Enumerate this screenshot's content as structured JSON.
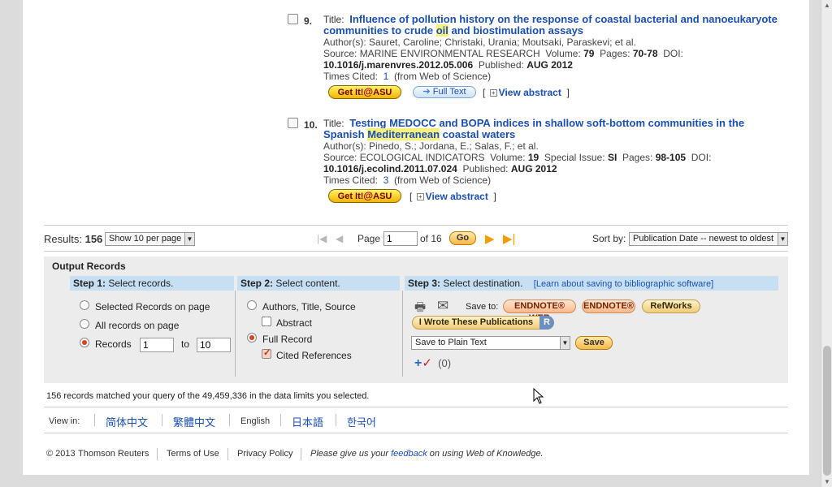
{
  "records": [
    {
      "number": "9.",
      "title_prefix": "Title:",
      "title_pre": "Influence of pollution history on the response of coastal bacterial and nanoeukaryote communities to crude ",
      "title_hl": "oil",
      "title_post": " and biostimulation assays",
      "authors": "Author(s): Sauret, Caroline; Christaki, Urania; Moutsaki, Paraskevi; et al.",
      "source_label": "Source: MARINE ENVIRONMENTAL RESEARCH",
      "volume_label": "Volume:",
      "volume": "79",
      "pages_label": "Pages:",
      "pages": "70-78",
      "doi_label": "DOI:",
      "doi": "10.1016/j.marenvres.2012.05.006",
      "published_label": "Published:",
      "published": "AUG 2012",
      "times_cited_label": "Times Cited:",
      "times_cited": "1",
      "times_cited_note": "(from Web of Science)",
      "get_it": "Get It!",
      "asu": "ASU",
      "full_text": "Full Text",
      "view_abstract": "View abstract"
    },
    {
      "number": "10.",
      "title_prefix": "Title:",
      "title_pre": "Testing MEDOCC and BOPA indices in shallow soft-bottom communities in the Spanish ",
      "title_hl": "Mediterranean",
      "title_post": " coastal waters",
      "authors": "Author(s): Pinedo, S.; Jordana, E.; Salas, F.; et al.",
      "source_label": "Source: ECOLOGICAL INDICATORS",
      "volume_label": "Volume:",
      "volume": "19",
      "special_label": "Special Issue:",
      "special": "SI",
      "pages_label": "Pages:",
      "pages": "98-105",
      "doi_label": "DOI:",
      "doi": "10.1016/j.ecolind.2011.07.024",
      "published_label": "Published:",
      "published": "AUG 2012",
      "times_cited_label": "Times Cited:",
      "times_cited": "3",
      "times_cited_note": "(from Web of Science)",
      "get_it": "Get It!",
      "asu": "ASU",
      "view_abstract": "View abstract"
    }
  ],
  "results_bar": {
    "results_label": "Results:",
    "results_count": "156",
    "per_page": "Show 10 per page",
    "page_label": "Page",
    "page_value": "1",
    "of_label": "of 16",
    "go": "Go",
    "sort_label": "Sort by:",
    "sort_value": "Publication Date -- newest to oldest"
  },
  "output": {
    "title": "Output Records",
    "step1_bold": "Step 1:",
    "step1_text": " Select records.",
    "step1_options": [
      "Selected Records on page",
      "All records on page",
      "Records"
    ],
    "records_from": "1",
    "records_to_label": "to",
    "records_to": "10",
    "step2_bold": "Step 2:",
    "step2_text": " Select content.",
    "step2_options": [
      "Authors, Title, Source",
      "Abstract",
      "Full Record",
      "Cited References"
    ],
    "step3_bold": "Step 3:",
    "step3_text": " Select destination.",
    "learn_link": "[Learn about saving to bibliographic software]",
    "save_to": "Save to:",
    "endnote_web": "ENDNOTE® WEB",
    "endnote": "ENDNOTE®",
    "refworks": "RefWorks",
    "i_wrote": "I Wrote These Publications",
    "rid": "R",
    "save_format": "Save to Plain Text",
    "save_btn": "Save",
    "marked_count": "(0)"
  },
  "matched_text": "156 records matched your query of the 49,459,336 in the data limits you selected.",
  "view_in": {
    "label": "View in:",
    "languages": [
      "简体中文",
      "繁體中文",
      "English",
      "日本語",
      "한국어"
    ]
  },
  "footer": {
    "copyright": "© 2013",
    "thomson": "Thomson Reuters",
    "terms": "Terms of Use",
    "privacy": "Privacy Policy",
    "please": "Please give us your",
    "feedback": "feedback",
    "on_using": "on using Web of Knowledge."
  }
}
